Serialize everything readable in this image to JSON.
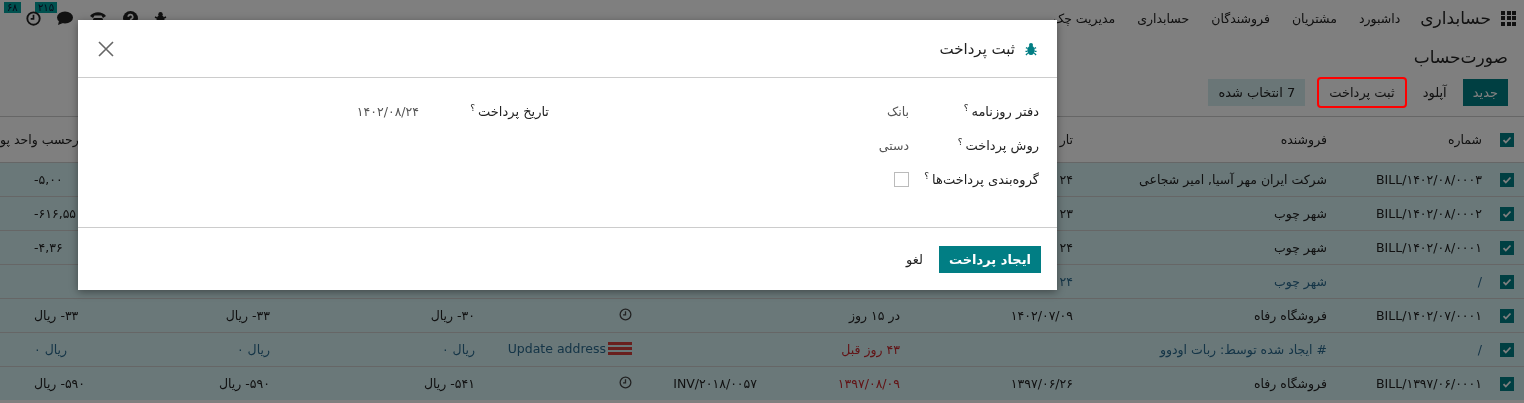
{
  "navbar": {
    "brand": "حسابداری",
    "menu": [
      "داشبورد",
      "مشتریان",
      "فروشندگان",
      "حسابداری",
      "مدیریت چک"
    ],
    "systray": [
      {
        "kind": "bug"
      },
      {
        "kind": "help"
      },
      {
        "kind": "phone"
      },
      {
        "kind": "chat",
        "badge": "۲۱۵"
      },
      {
        "kind": "clock",
        "badge": "۶۸"
      }
    ]
  },
  "breadcrumb": "صورت‌حساب",
  "actions": [
    {
      "label": "جدید",
      "kind": "primary",
      "highlighted": false
    },
    {
      "label": "آپلود",
      "kind": "link",
      "highlighted": false
    },
    {
      "label": "ثبت پرداخت",
      "kind": "secondary",
      "highlighted": true
    },
    {
      "label": "7 انتخاب شده",
      "kind": "counter",
      "highlighted": false
    }
  ],
  "table": {
    "select_all": true,
    "columns": [
      "شماره",
      "فروشنده",
      "تار",
      "رحسب واحد پو"
    ],
    "rows": [
      {
        "selected": true,
        "draft": false,
        "number": "BILL/۱۴۰۲/۰۸/۰۰۰۳",
        "vendor": "شرکت ایران مهر آسیا, امیر شجاعی",
        "bill_date": "۲۴",
        "total_currency": "۵,۰۰-"
      },
      {
        "selected": true,
        "draft": false,
        "number": "BILL/۱۴۰۲/۰۸/۰۰۰۲",
        "vendor": "شهر چوب",
        "bill_date": "۲۳",
        "total_currency": "۶۱۶,۵۵-"
      },
      {
        "selected": true,
        "draft": false,
        "number": "BILL/۱۴۰۲/۰۸/۰۰۰۱",
        "vendor": "شهر چوب",
        "bill_date": "۲۴",
        "total_currency": "۴,۳۶-"
      },
      {
        "selected": true,
        "draft": true,
        "number": "/",
        "vendor": "شهر چوب",
        "bill_date": "۲۴"
      },
      {
        "selected": true,
        "draft": false,
        "number": "BILL/۱۴۰۲/۰۷/۰۰۰۱",
        "vendor": "فروشگاه رفاه",
        "bill_date": "۱۴۰۲/۰۷/۰۹",
        "due_date": "در ۱۵ روز",
        "due_overdue": false,
        "activity": {
          "kind": "clock"
        },
        "untaxed": "۳۰- ریال",
        "total": "۳۳- ریال",
        "total_currency": "۳۳- ریال"
      },
      {
        "selected": true,
        "draft": true,
        "number": "/",
        "vendor": "# ایجاد شده توسط: ربات اودوو",
        "due_date": "۴۳ روز قبل",
        "due_overdue": true,
        "activity": {
          "kind": "todo",
          "label": "Update address"
        },
        "untaxed": "ریال ۰",
        "total": "ریال ۰",
        "total_currency": "ریال ۰"
      },
      {
        "selected": true,
        "draft": false,
        "number": "BILL/۱۳۹۷/۰۶/۰۰۰۱",
        "vendor": "فروشگاه رفاه",
        "bill_date": "۱۳۹۷/۰۶/۲۶",
        "due_date": "۱۳۹۷/۰۸/۰۹",
        "due_overdue": true,
        "reference": "INV/۲۰۱۸/۰۰۵۷",
        "activity": {
          "kind": "clock"
        },
        "untaxed": "۵۴۱- ریال",
        "total": "۵۹۰- ریال",
        "total_currency": "۵۹۰- ریال"
      }
    ]
  },
  "dialog": {
    "title": "ثبت پرداخت",
    "fields": [
      {
        "label": "دفتر روزنامه",
        "help": "؟",
        "kind": "text",
        "value": "بانک"
      },
      {
        "label": "روش پرداخت",
        "help": "؟",
        "kind": "text",
        "value": "دستی"
      },
      {
        "label": "گروه‌بندی پرداخت‌ها",
        "help": "؟",
        "kind": "checkbox",
        "checked": false
      }
    ],
    "side_fields": [
      {
        "label": "تاریخ پرداخت",
        "help": "؟",
        "kind": "text",
        "value": "۱۴۰۲/۰۸/۲۴"
      }
    ],
    "buttons": [
      {
        "label": "ایجاد پرداخت",
        "kind": "primary"
      },
      {
        "label": "لغو",
        "kind": "link"
      }
    ]
  }
}
